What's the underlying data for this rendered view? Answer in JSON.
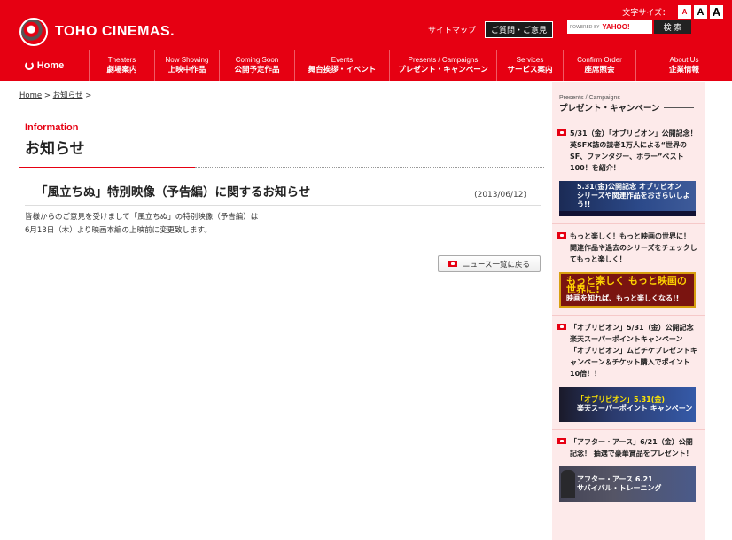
{
  "header": {
    "logo_text": "TOHO CINEMAS.",
    "font_size_label": "文字サイズ：",
    "font_sizes": [
      "A",
      "A",
      "A"
    ],
    "sitemap": "サイトマップ",
    "faq": "ご質問・ご意見",
    "search_powered": "POWERED BY",
    "search_provider": "YAHOO!",
    "search_button": "検 索"
  },
  "nav": {
    "home": "Home",
    "items": [
      {
        "en": "Theaters",
        "ja": "劇場案内"
      },
      {
        "en": "Now Showing",
        "ja": "上映中作品"
      },
      {
        "en": "Coming Soon",
        "ja": "公開予定作品"
      },
      {
        "en": "Events",
        "ja": "舞台挨拶・イベント"
      },
      {
        "en": "Presents / Campaigns",
        "ja": "プレゼント・キャンペーン"
      },
      {
        "en": "Services",
        "ja": "サービス案内"
      },
      {
        "en": "Confirm Order",
        "ja": "座席照会"
      },
      {
        "en": "About Us",
        "ja": "企業情報"
      }
    ]
  },
  "breadcrumb": {
    "home": "Home",
    "sep1": ">",
    "current": "お知らせ",
    "sep2": ">"
  },
  "page_title": {
    "en": "Information",
    "ja": "お知らせ"
  },
  "article": {
    "title": "「風立ちぬ」特別映像（予告編）に関するお知らせ",
    "date": "(2013/06/12)",
    "body_line1": "皆様からのご意見を受けまして「風立ちぬ」の特別映像（予告編）は",
    "body_line2": "6月13日（木）より映画本編の上映前に変更致します。",
    "back_button": "ニュース一覧に戻る"
  },
  "sidebar": {
    "title_en": "Presents / Campaigns",
    "title_ja": "プレゼント・キャンペーン",
    "promos": [
      {
        "text": "5/31（金）「オブリビオン」公開記念！英SFX誌の読者1万人による“世界のSF、ファンタジー、ホラー”ベスト100！を紹介！",
        "banner_l1": "5.31(金)公開記念 オブリビオン",
        "banner_l2": "シリーズや関連作品をおさらいしよう!!"
      },
      {
        "text": "もっと楽しく！もっと映画の世界に！ 関連作品や過去のシリーズをチェックしてもっと楽しく！",
        "banner_l1": "もっと楽しく もっと映画の世界に!",
        "banner_l2": "映画を知れば、もっと楽しくなる!!"
      },
      {
        "text": "「オブリビオン」5/31（金）公開記念　楽天スーパーポイントキャンペーン 「オブリビオン」ムビチケプレゼントキャンペーン＆チケット購入でポイント10倍！！",
        "banner_l1": "「オブリビオン」5.31(金)",
        "banner_l2": "楽天スーパーポイント キャンペーン"
      },
      {
        "text": "「アフター・アース」6/21（金）公開記念！ 抽選で豪華賞品をプレゼント！",
        "banner_l1": "アフター・アース 6.21",
        "banner_l2": "サバイバル・トレーニング"
      }
    ]
  }
}
